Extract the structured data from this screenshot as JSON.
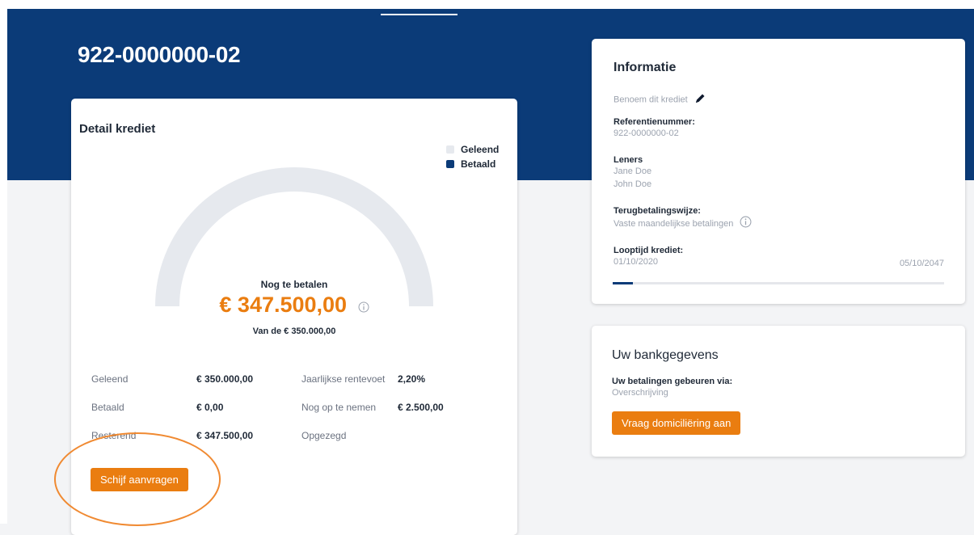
{
  "account": {
    "number": "922-0000000-02"
  },
  "detail": {
    "title": "Detail krediet",
    "legend": [
      {
        "label": "Geleend",
        "color": "#e6e9ee"
      },
      {
        "label": "Betaald",
        "color": "#0b3b78"
      }
    ],
    "gauge": {
      "paid_fraction": 0.0,
      "label": "Nog te betalen",
      "amount": "€ 347.500,00",
      "sub": "Van de € 350.000,00"
    },
    "stats": [
      {
        "label": "Geleend",
        "value": "€ 350.000,00",
        "label2": "Jaarlijkse rentevoet",
        "value2": "2,20%"
      },
      {
        "label": "Betaald",
        "value": "€ 0,00",
        "label2": "Nog op te nemen",
        "value2": "€ 2.500,00"
      },
      {
        "label": "Resterend",
        "value": "€ 347.500,00",
        "label2": "Opgezegd",
        "value2": ""
      }
    ],
    "request_button": "Schijf aanvragen"
  },
  "info": {
    "title": "Informatie",
    "rename": "Benoem dit krediet",
    "reference_label": "Referentienummer:",
    "reference_value": "922-0000000-02",
    "borrowers_label": "Leners",
    "borrowers": [
      "Jane Doe",
      "John Doe"
    ],
    "repayment_label": "Terugbetalingswijze:",
    "repayment_value": "Vaste maandelijkse betalingen",
    "term_label": "Looptijd krediet:",
    "term_start": "01/10/2020",
    "term_end": "05/10/2047",
    "term_progress": 0.06
  },
  "bank": {
    "title": "Uw bankgegevens",
    "payments_label": "Uw betalingen gebeuren via:",
    "payments_value": "Overschrijving",
    "button": "Vraag domiciliëring aan"
  },
  "colors": {
    "brand": "#0b3b78",
    "accent": "#ea7d10",
    "annotation": "#f08a32"
  },
  "icons": {
    "info": "info-icon",
    "edit": "pencil-icon"
  }
}
